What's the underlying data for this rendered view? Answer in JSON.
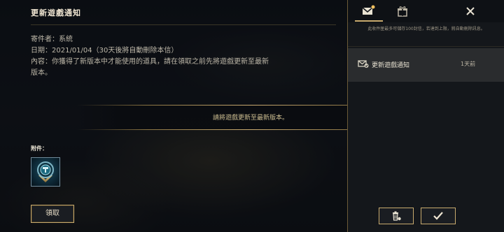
{
  "mail": {
    "title": "更新遊戲通知",
    "sender": "寄件者：系統",
    "date": "日期：2021/01/04（30天後將自動刪除本信）",
    "content_line1": "內容：你獲得了新版本中才能使用的道具，請在領取之前先將遊戲更新至最新",
    "content_line2": "版本。",
    "banner": "請將遊戲更新至最新版本。",
    "attachments_label": "附件：",
    "attachment_icon": "emblem-icon",
    "claim_label": "領取"
  },
  "inbox": {
    "tabs": [
      {
        "name": "mail-icon",
        "active": true,
        "has_unread": true
      },
      {
        "name": "gift-icon",
        "active": false
      },
      {
        "name": "close-icon",
        "active": false
      }
    ],
    "notice": "此收件匣最多可儲存100封信，若達到上限，將自動刪除訊息。",
    "items": [
      {
        "subject": "更新遊戲通知",
        "time": "1天前",
        "icon": "mail-update-icon",
        "selected": true
      }
    ],
    "delete_icon": "trash-icon",
    "confirm_icon": "checkmark-icon"
  },
  "colors": {
    "accent_gold": "#c8aa6e",
    "unread_dot": "#f0c060",
    "panel_bg": "#14171b",
    "selected_item_bg": "#2a2c2e"
  }
}
